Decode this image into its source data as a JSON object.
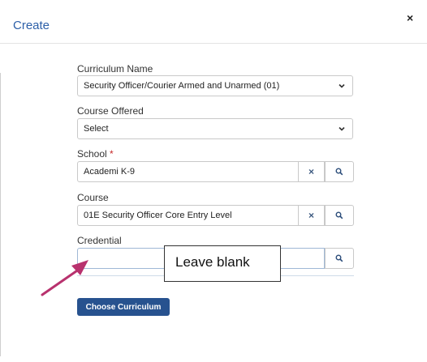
{
  "modal": {
    "title": "Create",
    "close_symbol": "×"
  },
  "form": {
    "curriculum_name": {
      "label": "Curriculum Name",
      "value": "Security Officer/Courier Armed and Unarmed (01)"
    },
    "course_offered": {
      "label": "Course Offered",
      "value": "Select"
    },
    "school": {
      "label": "School",
      "required_mark": "*",
      "value": "Academi K-9",
      "clear_symbol": "×"
    },
    "course": {
      "label": "Course",
      "value": "01E Security Officer Core Entry Level",
      "clear_symbol": "×"
    },
    "credential": {
      "label": "Credential",
      "value": ""
    }
  },
  "actions": {
    "choose_curriculum_label": "Choose Curriculum"
  },
  "annotation": {
    "callout_text": "Leave blank",
    "arrow_color": "#b8326e"
  },
  "colors": {
    "primary": "#27528f",
    "title": "#2c5fa8",
    "required": "#c62828"
  }
}
